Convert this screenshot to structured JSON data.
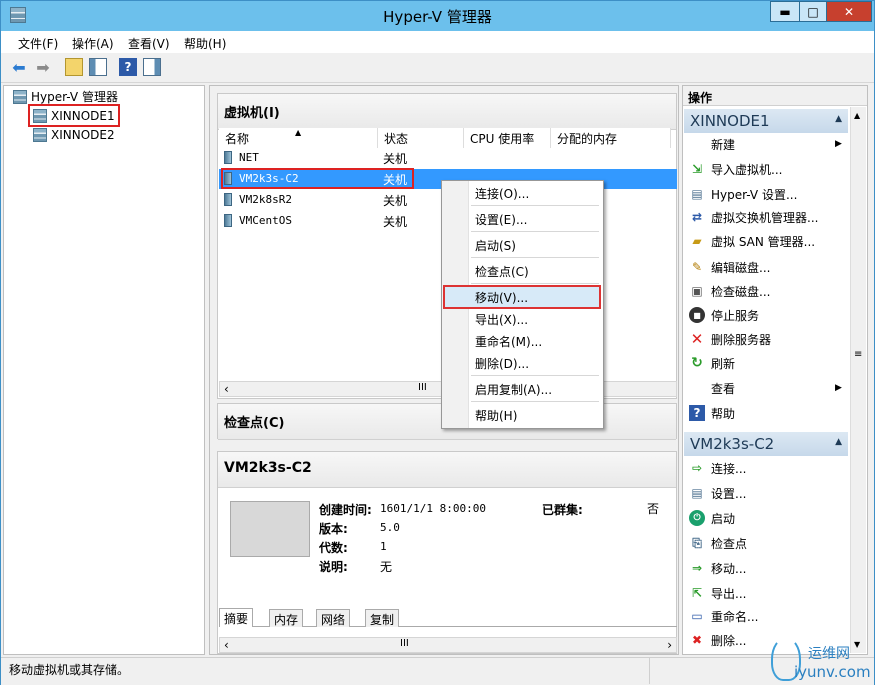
{
  "window": {
    "title": "Hyper-V 管理器",
    "minimize": "▬",
    "maximize": "□",
    "close": "✕"
  },
  "menu": [
    "文件(F)",
    "操作(A)",
    "查看(V)",
    "帮助(H)"
  ],
  "tree": {
    "root": "Hyper-V 管理器",
    "nodes": [
      "XINNODE1",
      "XINNODE2"
    ]
  },
  "vms_panel": {
    "title": "虚拟机(I)",
    "columns": [
      "名称",
      "状态",
      "CPU 使用率",
      "分配的内存"
    ],
    "rows": [
      {
        "name": "NET",
        "state": "关机"
      },
      {
        "name": "VM2k3s-C2",
        "state": "关机"
      },
      {
        "name": "VM2k8sR2",
        "state": "关机"
      },
      {
        "name": "VMCentOS",
        "state": "关机"
      }
    ],
    "scroll_mid": "III"
  },
  "checkpoints_panel": {
    "title": "检查点(C)"
  },
  "details_panel": {
    "title": "VM2k3s-C2",
    "created_label": "创建时间:",
    "created_value": "1601/1/1 8:00:00",
    "version_label": "版本:",
    "version_value": "5.0",
    "generation_label": "代数:",
    "generation_value": "1",
    "notes_label": "说明:",
    "notes_value": "无",
    "clustered_label": "已群集:",
    "clustered_value": "否",
    "tabs": [
      "摘要",
      "内存",
      "网络",
      "复制"
    ],
    "scroll_mid": "III"
  },
  "context_menu": [
    "连接(O)...",
    "设置(E)...",
    "启动(S)",
    "检查点(C)",
    "移动(V)...",
    "导出(X)...",
    "重命名(M)...",
    "删除(D)...",
    "启用复制(A)...",
    "帮助(H)"
  ],
  "actions": {
    "header": "操作",
    "section1": "XINNODE1",
    "items1": [
      "新建",
      "导入虚拟机...",
      "Hyper-V 设置...",
      "虚拟交换机管理器...",
      "虚拟 SAN 管理器...",
      "编辑磁盘...",
      "检查磁盘...",
      "停止服务",
      "删除服务器",
      "刷新",
      "查看",
      "帮助"
    ],
    "section2": "VM2k3s-C2",
    "items2": [
      "连接...",
      "设置...",
      "启动",
      "检查点",
      "移动...",
      "导出...",
      "重命名...",
      "删除..."
    ]
  },
  "status_text": "移动虚拟机或其存储。",
  "watermark": {
    "line1": "运维网",
    "line2": "iyunv.com"
  },
  "colors": {
    "selection": "#3399ff",
    "highlight_box": "#dd2222",
    "titlebar": "#6cc0ec"
  }
}
